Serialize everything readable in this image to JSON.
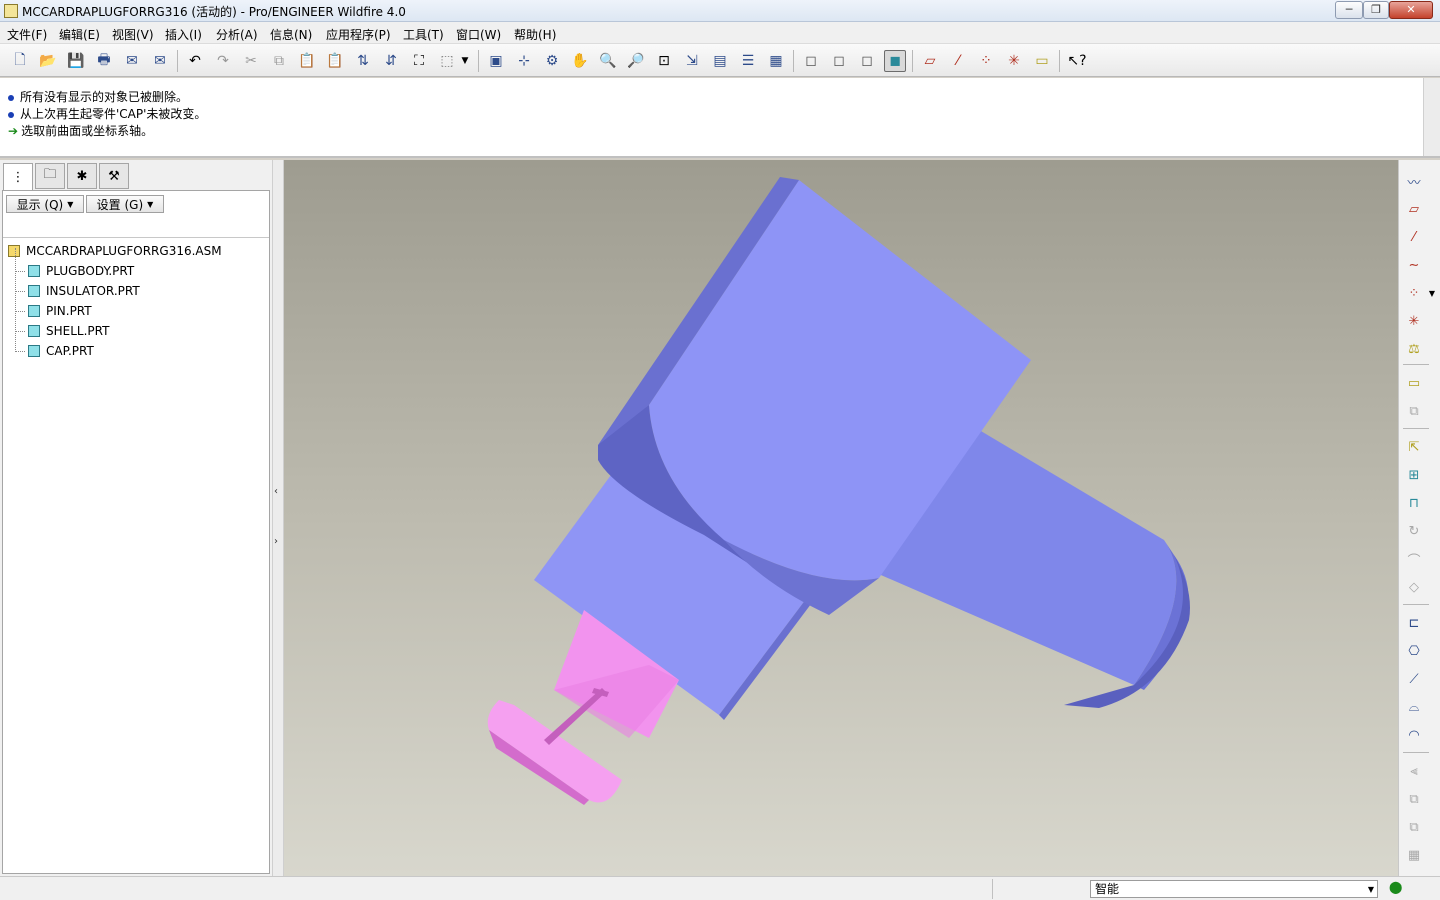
{
  "window": {
    "title": "MCCARDRAPLUGFORRG316 (活动的) - Pro/ENGINEER Wildfire 4.0",
    "minimize": "─",
    "maximize": "❐",
    "close": "✕"
  },
  "menu": {
    "items": [
      "文件(F)",
      "编辑(E)",
      "视图(V)",
      "插入(I)",
      "分析(A)",
      "信息(N)",
      "应用程序(P)",
      "工具(T)",
      "窗口(W)",
      "帮助(H)"
    ]
  },
  "toolbar": {
    "icons": [
      "new-file-icon",
      "open-file-icon",
      "save-icon",
      "print-icon",
      "email-icon",
      "email-link-icon",
      "undo-icon",
      "redo-icon",
      "cut-icon",
      "copy-icon",
      "paste-icon",
      "paste-special-icon",
      "regenerate-icon",
      "regen-manager-icon",
      "find-icon",
      "select-box-icon",
      "dropdown-icon",
      "repaint-icon",
      "spin-center-icon",
      "orient-mode-icon",
      "pan-icon",
      "zoom-in-icon",
      "zoom-out-icon",
      "refit-icon",
      "reorient-icon",
      "saved-views-icon",
      "layers-icon",
      "view-manager-icon",
      "wireframe-icon",
      "hidden-line-icon",
      "no-hidden-icon",
      "shading-icon",
      "datum-planes-icon",
      "datum-axes-icon",
      "datum-points-icon",
      "coord-sys-icon",
      "annotations-icon",
      "context-help-icon"
    ]
  },
  "messages": {
    "line1": "所有没有显示的对象已被删除。",
    "line2": "从上次再生起零件'CAP'未被改变。",
    "line3": "选取前曲面或坐标系轴。",
    "arrow": "➔"
  },
  "panel": {
    "display_button": "显示 (Q)",
    "settings_button": "设置 (G)",
    "tree": {
      "root": "MCCARDRAPLUGFORRG316.ASM",
      "children": [
        "PLUGBODY.PRT",
        "INSULATOR.PRT",
        "PIN.PRT",
        "SHELL.PRT",
        "CAP.PRT"
      ]
    }
  },
  "splitter": {
    "collapse": "‹",
    "expand": "›"
  },
  "status": {
    "filter_value": "智能"
  },
  "colors": {
    "shell_front": "#8c93f6",
    "shell_side": "#646bc7",
    "pin": "#f07ee8",
    "background_top": "#9e9c90",
    "background_bottom": "#d8d7cd"
  }
}
